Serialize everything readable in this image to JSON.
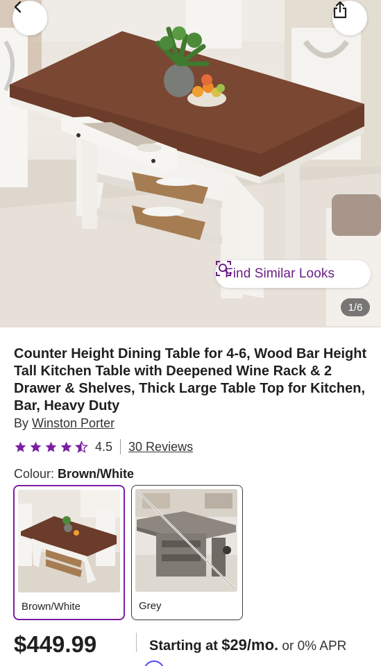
{
  "hero": {
    "image_counter": "1/6",
    "find_similar_label": "Find Similar Looks"
  },
  "product": {
    "title": "Counter Height Dining Table for 4-6, Wood Bar Height Tall Kitchen Table with Deepened Wine Rack & 2 Drawer & Shelves, Thick Large Table Top for Kitchen, Bar, Heavy Duty",
    "by_prefix": "By",
    "brand": "Winston Porter",
    "rating_value": "4.5",
    "rating_stars": 4.5,
    "reviews_label": "30 Reviews"
  },
  "colour": {
    "label": "Colour:",
    "selected": "Brown/White",
    "options": [
      {
        "label": "Brown/White"
      },
      {
        "label": "Grey"
      }
    ]
  },
  "pricing": {
    "price": "$449.99",
    "starting_at": "Starting at",
    "monthly": "$29/mo.",
    "apr_text": "or 0% APR",
    "or_text": "or"
  },
  "colors": {
    "accent": "#7b1fa2",
    "star": "#7b1fa2",
    "find_similar_text": "#6b1f86",
    "affirm": "#4a4af4"
  },
  "icons": {
    "back": "chevron-left-icon",
    "share": "share-icon",
    "find_similar": "visual-search-icon",
    "star": "star-icon"
  }
}
